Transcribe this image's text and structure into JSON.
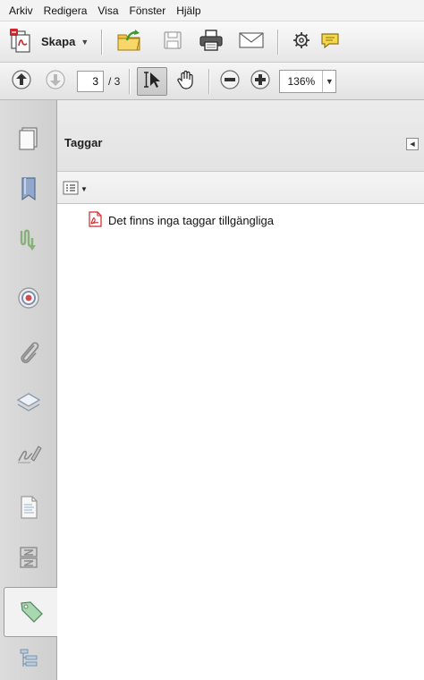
{
  "menubar": {
    "items": [
      "Arkiv",
      "Redigera",
      "Visa",
      "Fönster",
      "Hjälp"
    ]
  },
  "toolbar": {
    "create_label": "Skapa",
    "icons": [
      "create-pdf-icon",
      "open-folder-icon",
      "save-icon",
      "print-icon",
      "email-icon",
      "settings-icon",
      "comment-icon"
    ]
  },
  "navigation": {
    "current_page": "3",
    "total_pages": "/ 3",
    "zoom": "136%"
  },
  "leftrail": {
    "icons": [
      "page-thumbnails-icon",
      "bookmarks-icon",
      "signatures-icon",
      "layers-target-icon",
      "attachments-icon",
      "layers-icon",
      "sign-icon",
      "content-icon",
      "model-tree-icon",
      "tags-icon",
      "order-icon"
    ],
    "active": "tags-icon"
  },
  "panel": {
    "title": "Taggar",
    "empty_message": "Det finns inga taggar tillgängliga"
  },
  "colors": {
    "accent_pdf_red": "#d1252a",
    "rail_bg": "#d4d4d4",
    "panel_bg": "#ffffff"
  }
}
